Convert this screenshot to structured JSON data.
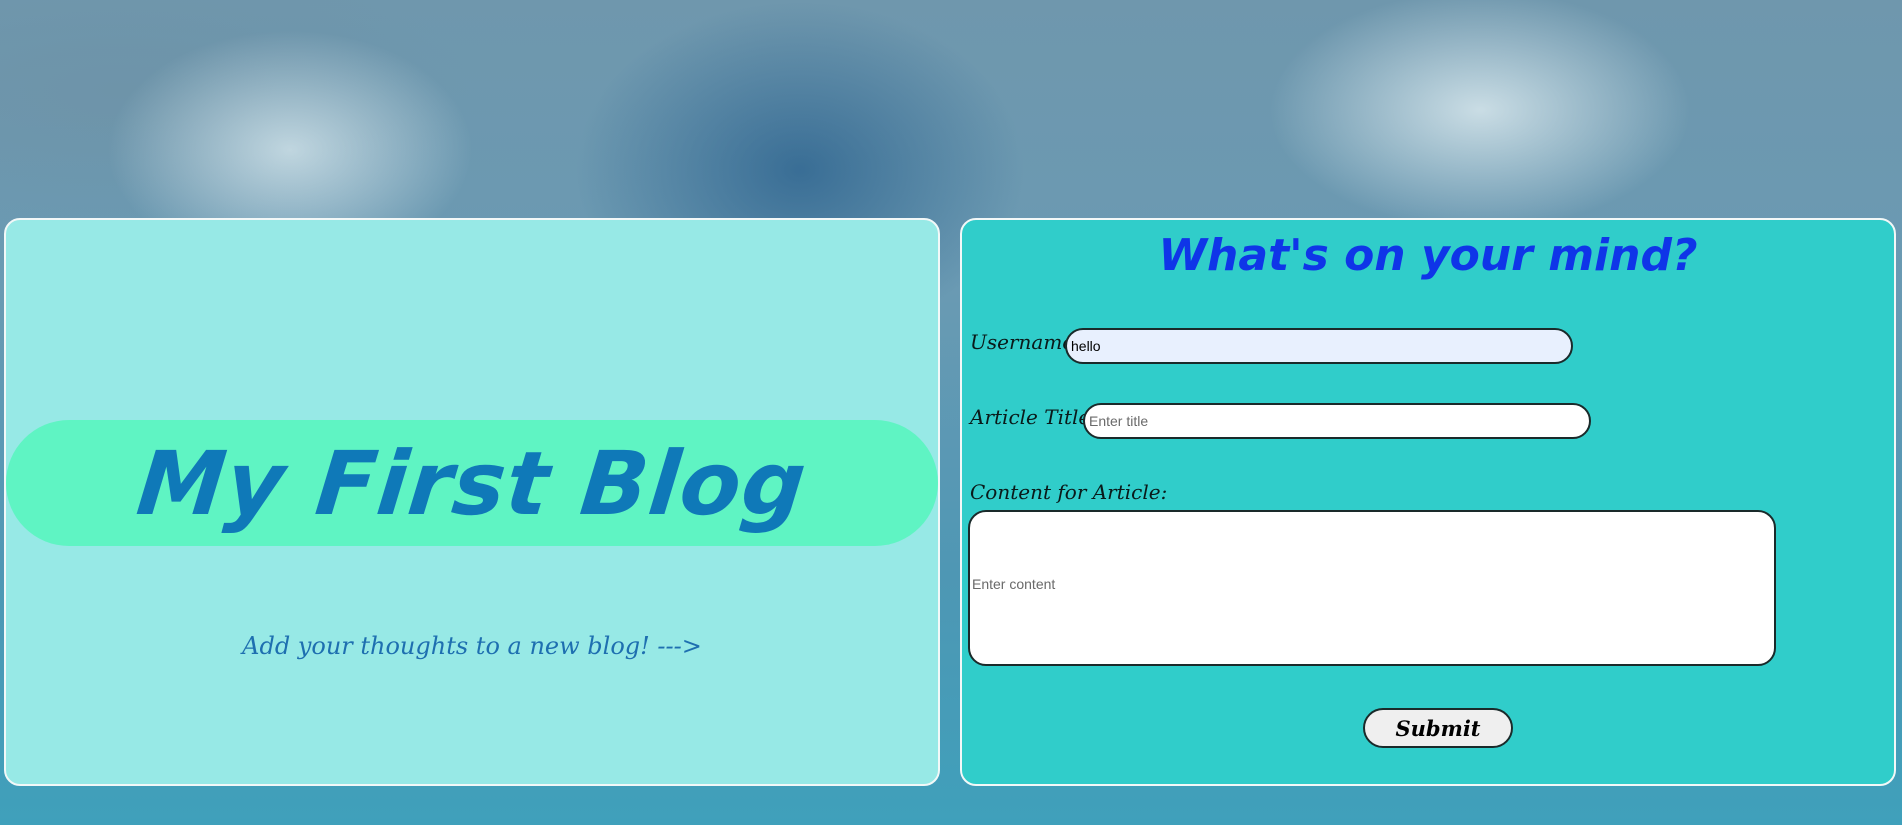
{
  "hero": {
    "title": "My First Blog",
    "tagline": "Add your thoughts to a new blog! --->"
  },
  "form": {
    "heading": "What's on your mind?",
    "username": {
      "label": "Username:",
      "value": "hello"
    },
    "title": {
      "label": "Article Title:",
      "placeholder": "Enter title"
    },
    "content": {
      "label": "Content for Article:",
      "placeholder": "Enter content"
    },
    "submit_label": "Submit"
  }
}
